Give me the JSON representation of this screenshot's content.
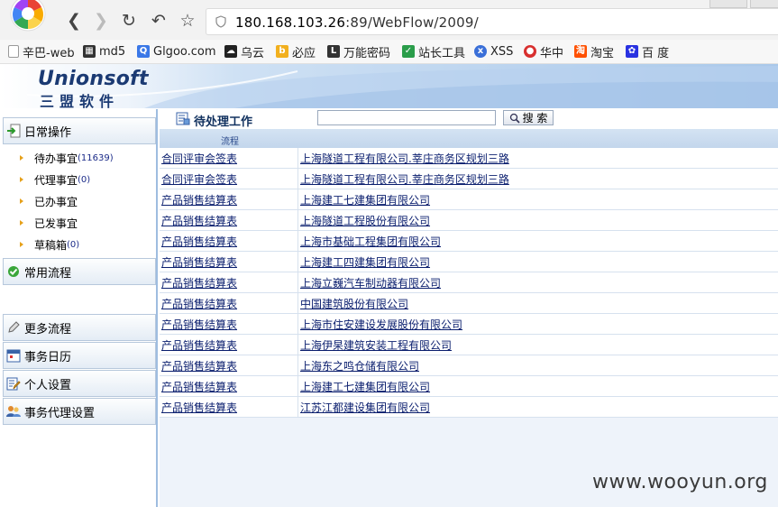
{
  "browser": {
    "url_host": "180.168.103.26",
    "url_rest": ":89/WebFlow/2009/",
    "bookmarks": [
      {
        "label": "辛巴-web",
        "icon": "page-icon",
        "color": "#888888"
      },
      {
        "label": "md5",
        "icon": "grid-icon",
        "color": "#333333"
      },
      {
        "label": "Glgoo.com",
        "icon": "search-icon",
        "color": "#3b78e7"
      },
      {
        "label": "乌云",
        "icon": "cloud-icon",
        "color": "#222222"
      },
      {
        "label": "必应",
        "icon": "bing-icon",
        "color": "#f2b01e"
      },
      {
        "label": "万能密码",
        "icon": "letter-l-icon",
        "color": "#333333"
      },
      {
        "label": "站长工具",
        "icon": "tool-icon",
        "color": "#2a9d4a"
      },
      {
        "label": "XSS",
        "icon": "xss-icon",
        "color": "#3a6fd8"
      },
      {
        "label": "华中",
        "icon": "red-bird-icon",
        "color": "#d8302f"
      },
      {
        "label": "淘宝",
        "icon": "taobao-icon",
        "color": "#ff5000"
      },
      {
        "label": "百 度",
        "icon": "baidu-paw-icon",
        "color": "#2932e1"
      }
    ]
  },
  "header": {
    "brand": "Unionsoft",
    "brand_cn": "三盟软件"
  },
  "sidebar": {
    "daily_ops": "日常操作",
    "daily_items": [
      {
        "label": "待办事宜",
        "count": "(11639)"
      },
      {
        "label": "代理事宜",
        "count": "(0)"
      },
      {
        "label": "已办事宜",
        "count": ""
      },
      {
        "label": "已发事宜",
        "count": ""
      },
      {
        "label": "草稿箱",
        "count": "(0)"
      }
    ],
    "common_flow": "常用流程",
    "more_flow": "更多流程",
    "calendar": "事务日历",
    "personal": "个人设置",
    "delegate": "事务代理设置"
  },
  "main": {
    "title": "待处理工作",
    "search_value": "",
    "search_label": "搜 索",
    "column_header": "流程",
    "rows": [
      {
        "flow": "合同评审会签表",
        "company": "上海隧道工程有限公司.莘庄商务区规划三路"
      },
      {
        "flow": "合同评审会签表",
        "company": "上海隧道工程有限公司.莘庄商务区规划三路"
      },
      {
        "flow": "产品销售结算表",
        "company": "上海建工七建集团有限公司"
      },
      {
        "flow": "产品销售结算表",
        "company": "上海隧道工程股份有限公司"
      },
      {
        "flow": "产品销售结算表",
        "company": "上海市基础工程集团有限公司"
      },
      {
        "flow": "产品销售结算表",
        "company": "上海建工四建集团有限公司"
      },
      {
        "flow": "产品销售结算表",
        "company": "上海立巍汽车制动器有限公司"
      },
      {
        "flow": "产品销售结算表",
        "company": "中国建筑股份有限公司"
      },
      {
        "flow": "产品销售结算表",
        "company": "上海市住安建设发展股份有限公司"
      },
      {
        "flow": "产品销售结算表",
        "company": "上海伊杲建筑安装工程有限公司"
      },
      {
        "flow": "产品销售结算表",
        "company": "上海东之鸣仓储有限公司"
      },
      {
        "flow": "产品销售结算表",
        "company": "上海建工七建集团有限公司"
      },
      {
        "flow": "产品销售结算表",
        "company": "江苏江都建设集团有限公司"
      }
    ]
  },
  "watermark": "www.wooyun.org",
  "colors": {
    "link": "#0a1e6e",
    "header_blue": "#1b3a73",
    "panel_bg": "#eef3fa"
  }
}
